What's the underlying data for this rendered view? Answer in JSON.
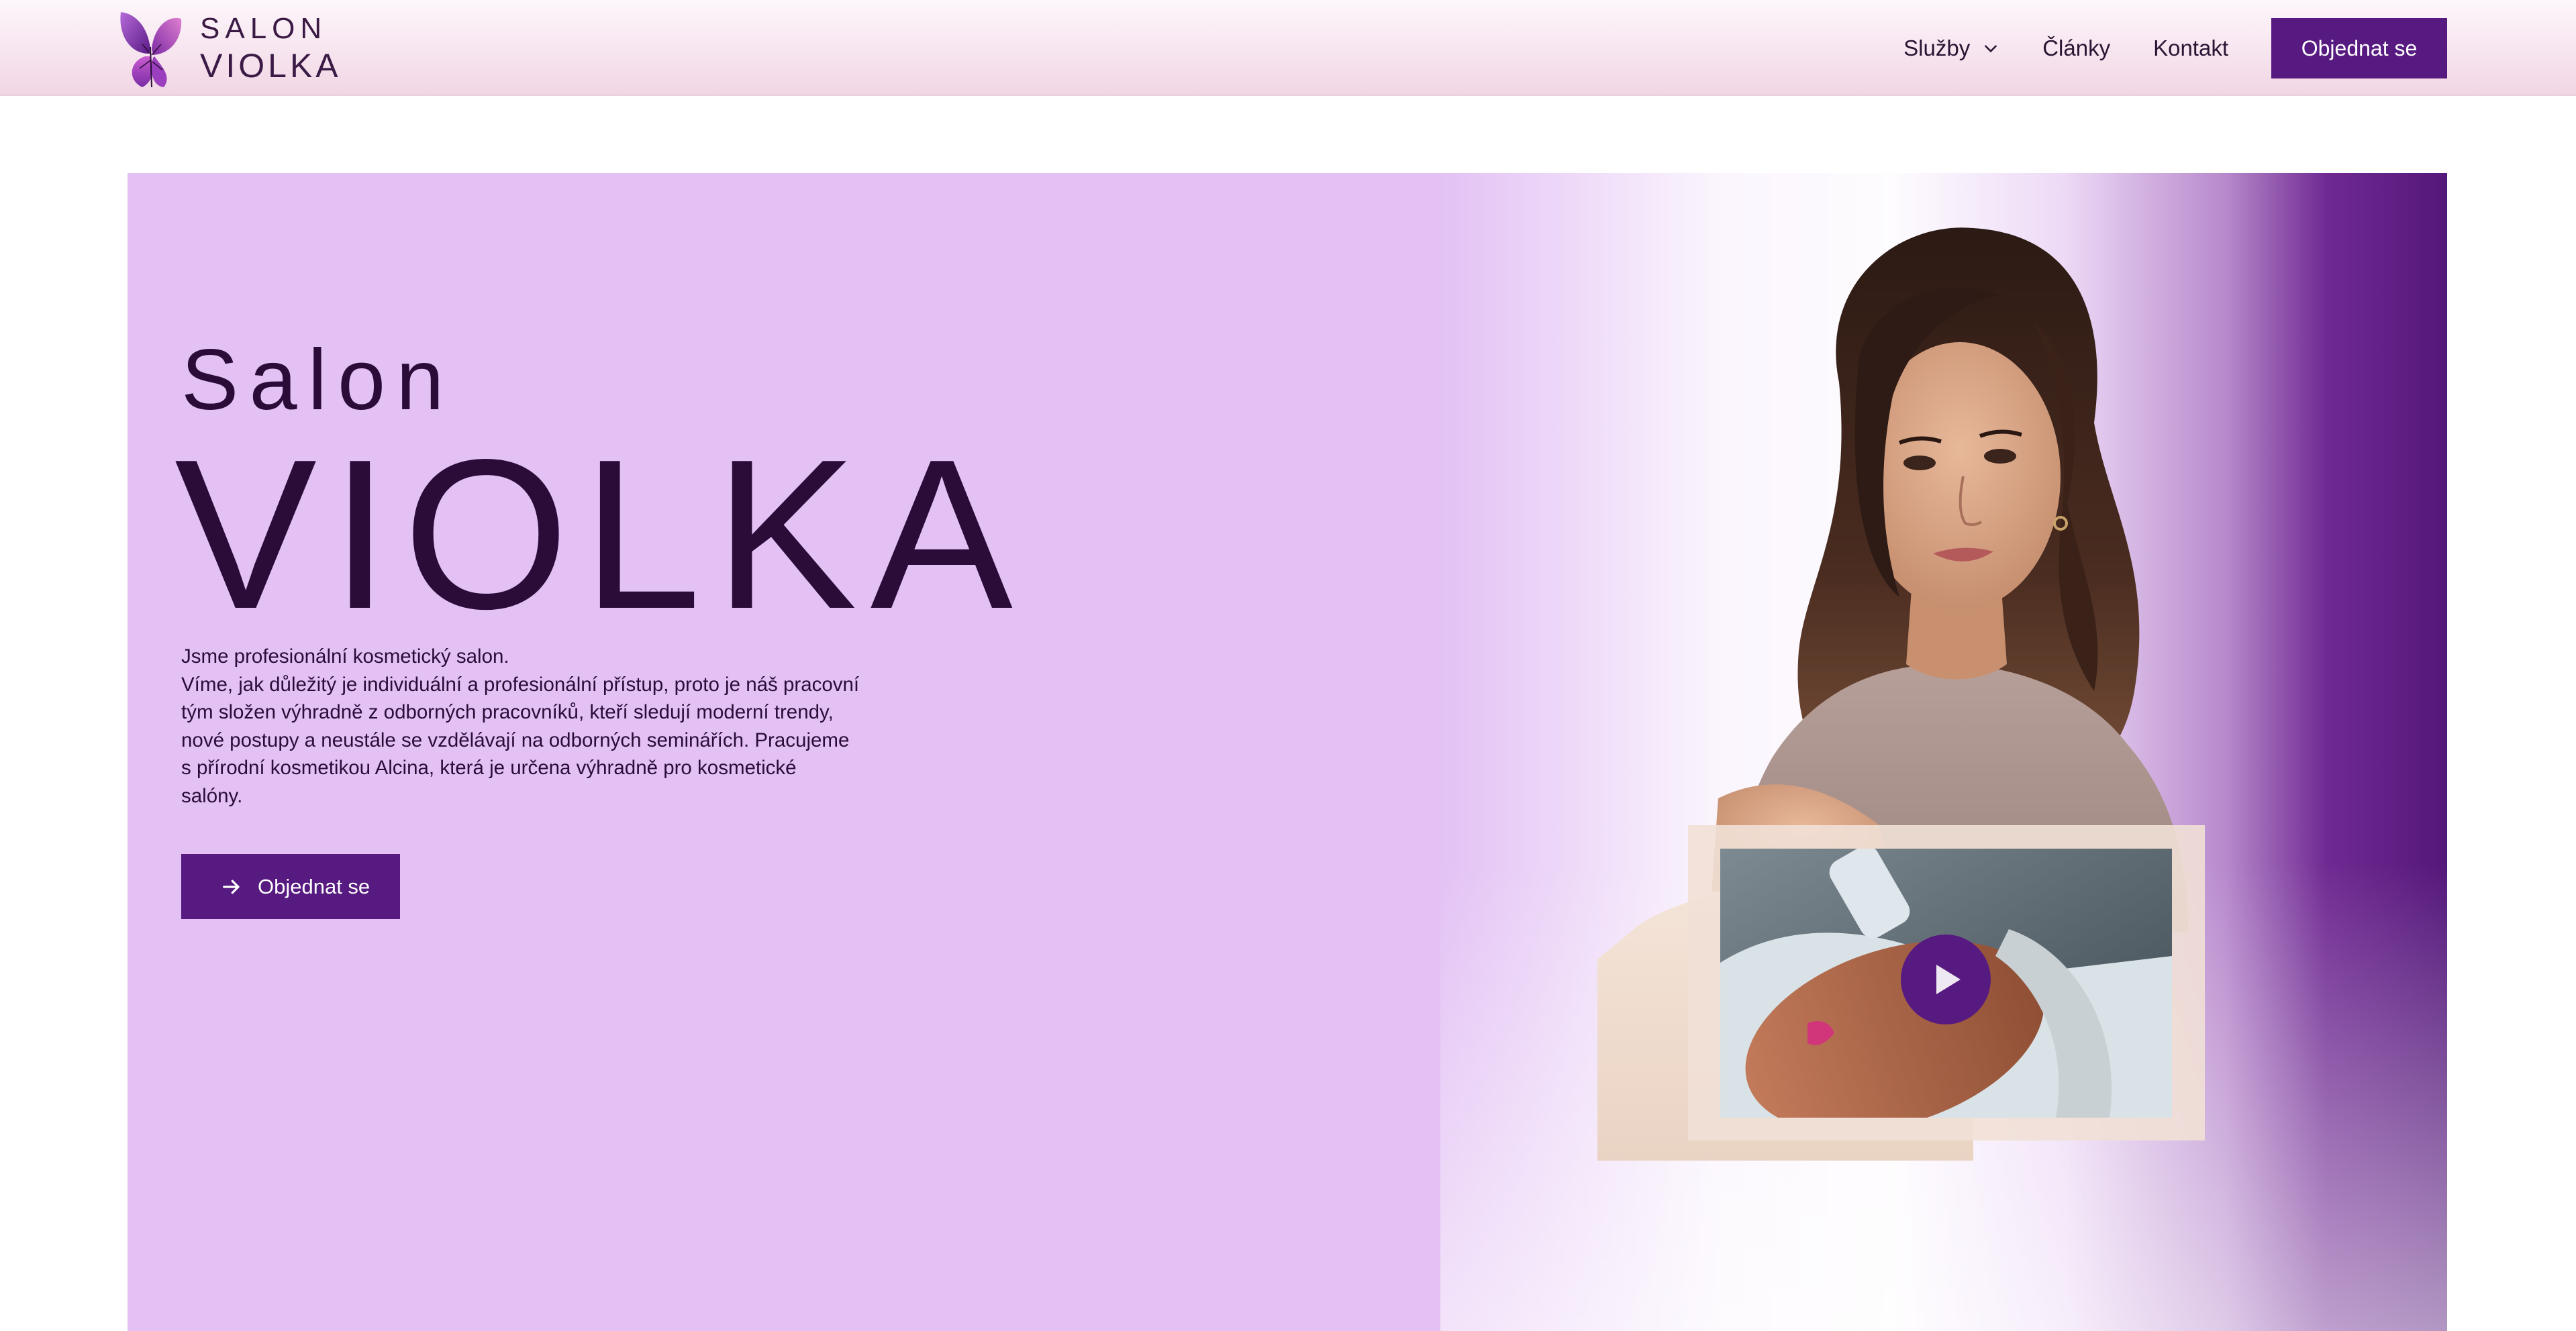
{
  "header": {
    "logo": {
      "line1": "SALON",
      "line2": "VIOLKA"
    },
    "nav": {
      "services_label": "Služby",
      "articles_label": "Články",
      "contact_label": "Kontakt",
      "cta_label": "Objednat se"
    }
  },
  "hero": {
    "title_small": "Salon",
    "title_big": "VIOLKA",
    "paragraph_lines": [
      "Jsme profesionální kosmetický salon.",
      "Víme, jak důležitý je individuální a profesionální přístup, proto je náš pracovní",
      "tým složen výhradně z odborných pracovníků, kteří sledují moderní trendy,",
      "nové postupy a neustále se vzdělávají na odborných seminářích. Pracujeme",
      "s přírodní kosmetikou Alcina, která je určena výhradně pro kosmetické",
      "salóny."
    ],
    "cta_label": "Objednat se"
  },
  "colors": {
    "brand_purple": "#571a80",
    "hero_bg": "#e3c1f4",
    "text_dark": "#2b0c38"
  },
  "icons": {
    "logo": "violet-flower-icon",
    "services_dropdown": "chevron-down-icon",
    "cta_arrow": "arrow-right-icon",
    "video_play": "play-icon"
  }
}
